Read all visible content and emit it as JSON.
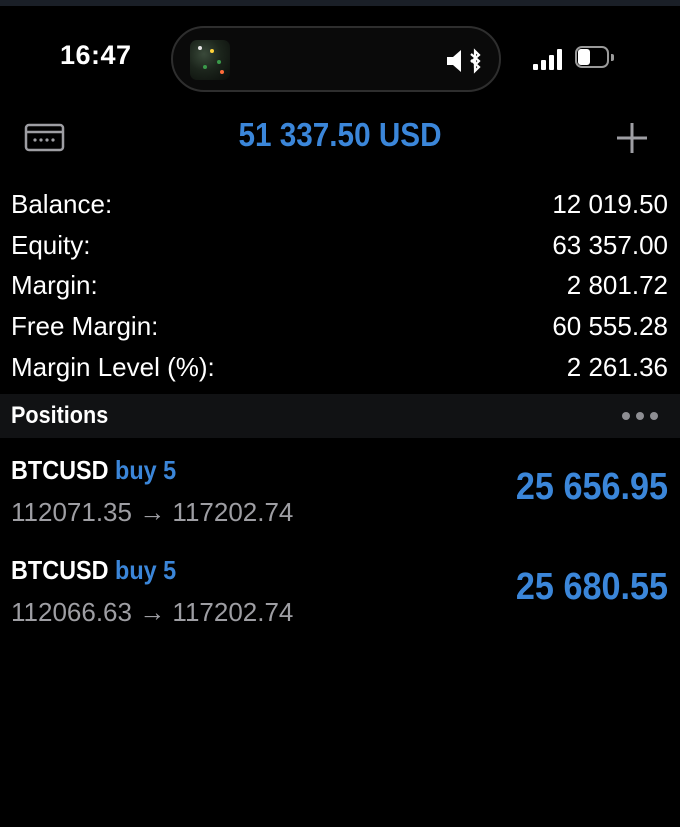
{
  "status_bar": {
    "time": "16:47"
  },
  "header": {
    "title": "51 337.50 USD",
    "left_icon": "accounts-icon",
    "right_icon": "plus-icon"
  },
  "summary": [
    {
      "label": "Balance:",
      "value": "12 019.50"
    },
    {
      "label": "Equity:",
      "value": "63 357.00"
    },
    {
      "label": "Margin:",
      "value": "2 801.72"
    },
    {
      "label": "Free Margin:",
      "value": "60 555.28"
    },
    {
      "label": "Margin Level (%):",
      "value": "2 261.36"
    }
  ],
  "positions": {
    "title": "Positions",
    "items": [
      {
        "symbol": "BTCUSD",
        "side": "buy 5",
        "prices": "112071.35 → 117202.74",
        "profit": "25 656.95"
      },
      {
        "symbol": "BTCUSD",
        "side": "buy 5",
        "prices": "112066.63 → 117202.74",
        "profit": "25 680.55"
      }
    ]
  },
  "colors": {
    "accent": "#3b86d9",
    "background": "#000000",
    "muted_text": "#9e9ea3",
    "section_bg": "#111214"
  }
}
